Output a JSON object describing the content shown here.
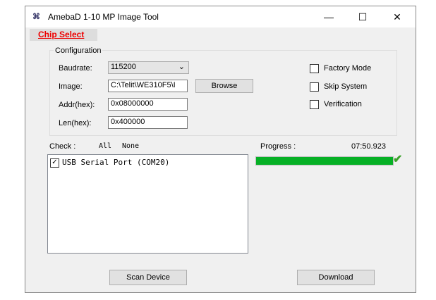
{
  "window": {
    "title": "AmebaD 1-10 MP Image Tool",
    "minimize": "—",
    "maximize": "☐",
    "close": "✕"
  },
  "menu": {
    "chip_select": "Chip Select"
  },
  "config": {
    "group_label": "Configuration",
    "baudrate_label": "Baudrate:",
    "baudrate_value": "115200",
    "image_label": "Image:",
    "image_value": "C:\\Telit\\WE310F5\\I",
    "browse": "Browse",
    "addr_label": "Addr(hex):",
    "addr_value": "0x08000000",
    "len_label": "Len(hex):",
    "len_value": "0x400000",
    "factory_mode": "Factory Mode",
    "skip_system": "Skip System",
    "verification": "Verification"
  },
  "check": {
    "label": "Check :",
    "all": "All",
    "none": "None"
  },
  "devices": [
    {
      "label": "USB Serial Port (COM20)",
      "checked": true
    }
  ],
  "progress": {
    "label": "Progress :",
    "time": "07:50.923",
    "percent": 100,
    "color": "#06b025"
  },
  "buttons": {
    "scan": "Scan Device",
    "download": "Download"
  }
}
